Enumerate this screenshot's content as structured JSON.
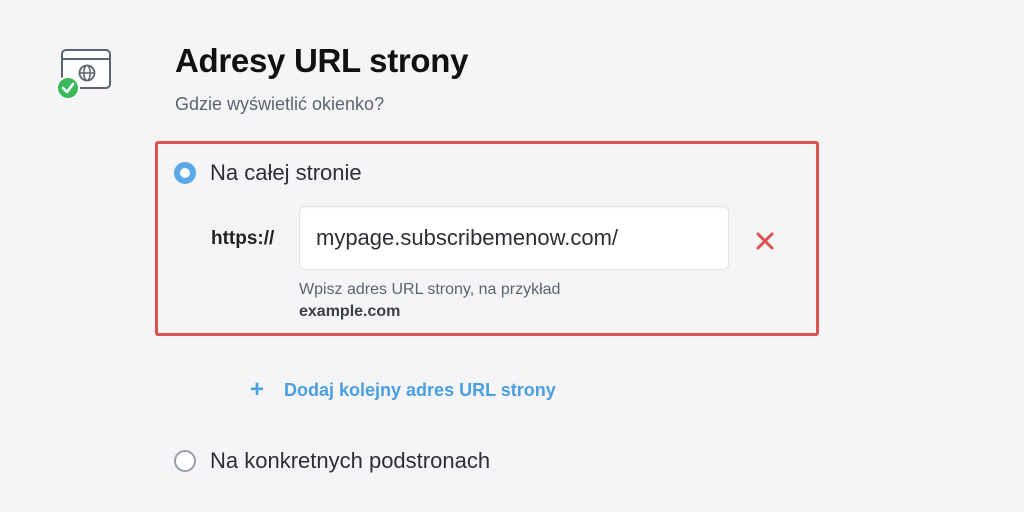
{
  "section": {
    "icon": "browser-globe-check-icon",
    "title": "Adresy URL strony",
    "subtitle": "Gdzie wyświetlić okienko?"
  },
  "options": {
    "whole_site": {
      "label": "Na całej stronie",
      "selected": true
    },
    "specific_pages": {
      "label": "Na konkretnych podstronach",
      "selected": false
    }
  },
  "url_entry": {
    "prefix": "https://",
    "value": "mypage.subscribemenow.com/",
    "hint_text": "Wpisz adres URL strony, na przykład",
    "hint_example": "example.com",
    "remove_icon": "close-icon"
  },
  "add_link": {
    "icon": "plus-icon",
    "label": "Dodaj kolejny adres URL strony"
  },
  "colors": {
    "accent": "#4a9fe0",
    "highlight_border": "#d9534f",
    "check_green": "#3cb95b",
    "remove_red": "#d9534f"
  }
}
